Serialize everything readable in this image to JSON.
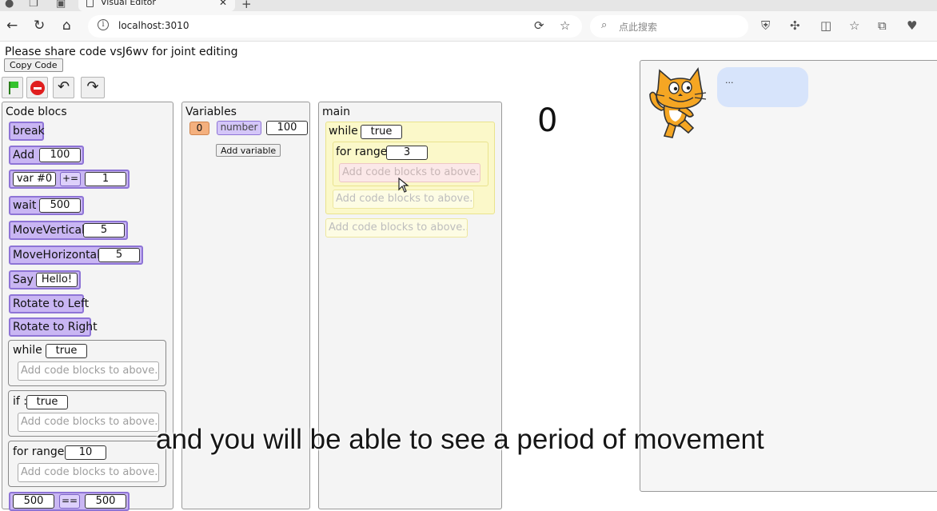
{
  "browser": {
    "tab_title": "Visual Editor",
    "url": "localhost:3010",
    "search_placeholder": "点此搜索"
  },
  "page": {
    "share_message": "Please share code vsJ6wv for joint editing",
    "copy_button": "Copy Code",
    "counter": "0",
    "subtitle": "and you will be able to see a period of movement"
  },
  "palette": {
    "title": "Code blocs",
    "break": "break",
    "add": {
      "label": "Add :",
      "value": "100"
    },
    "var_op": {
      "var": "var #0",
      "op": "+=",
      "value": "1"
    },
    "wait": {
      "label": "wait :",
      "value": "500"
    },
    "move_vertical": {
      "label": "MoveVertical :",
      "value": "5"
    },
    "move_horizontal": {
      "label": "MoveHorizontal :",
      "value": "5"
    },
    "say": {
      "label": "Say :",
      "value": "Hello!"
    },
    "rotate_left": "Rotate to Left",
    "rotate_right": "Rotate to Right",
    "while": {
      "label": "while :",
      "value": "true",
      "drop": "Add code blocks to above..."
    },
    "if": {
      "label": "if :",
      "value": "true",
      "drop": "Add code blocks to above..."
    },
    "for_range": {
      "label": "for range :",
      "value": "10",
      "drop": "Add code blocks to above..."
    },
    "compare": {
      "left": "500",
      "op": "==",
      "right": "500"
    }
  },
  "variables": {
    "title": "Variables",
    "id": "0",
    "type": "number",
    "value": "100",
    "add_button": "Add variable"
  },
  "main": {
    "title": "main",
    "while": {
      "label": "while :",
      "value": "true"
    },
    "for_range": {
      "label": "for range :",
      "value": "3",
      "drop": "Add code blocks to above..."
    },
    "while_drop": "Add code blocks to above...",
    "main_drop": "Add code blocks to above..."
  },
  "stage": {
    "speech": "..."
  },
  "colors": {
    "block_fill": "#c9b6f3",
    "block_border": "#8e74d6",
    "loop_fill": "#fbf8c9",
    "variable_id": "#f4b07e",
    "speech_bubble": "#d7e4fb",
    "stop": "#e01e1e",
    "flag": "#35c22d"
  }
}
